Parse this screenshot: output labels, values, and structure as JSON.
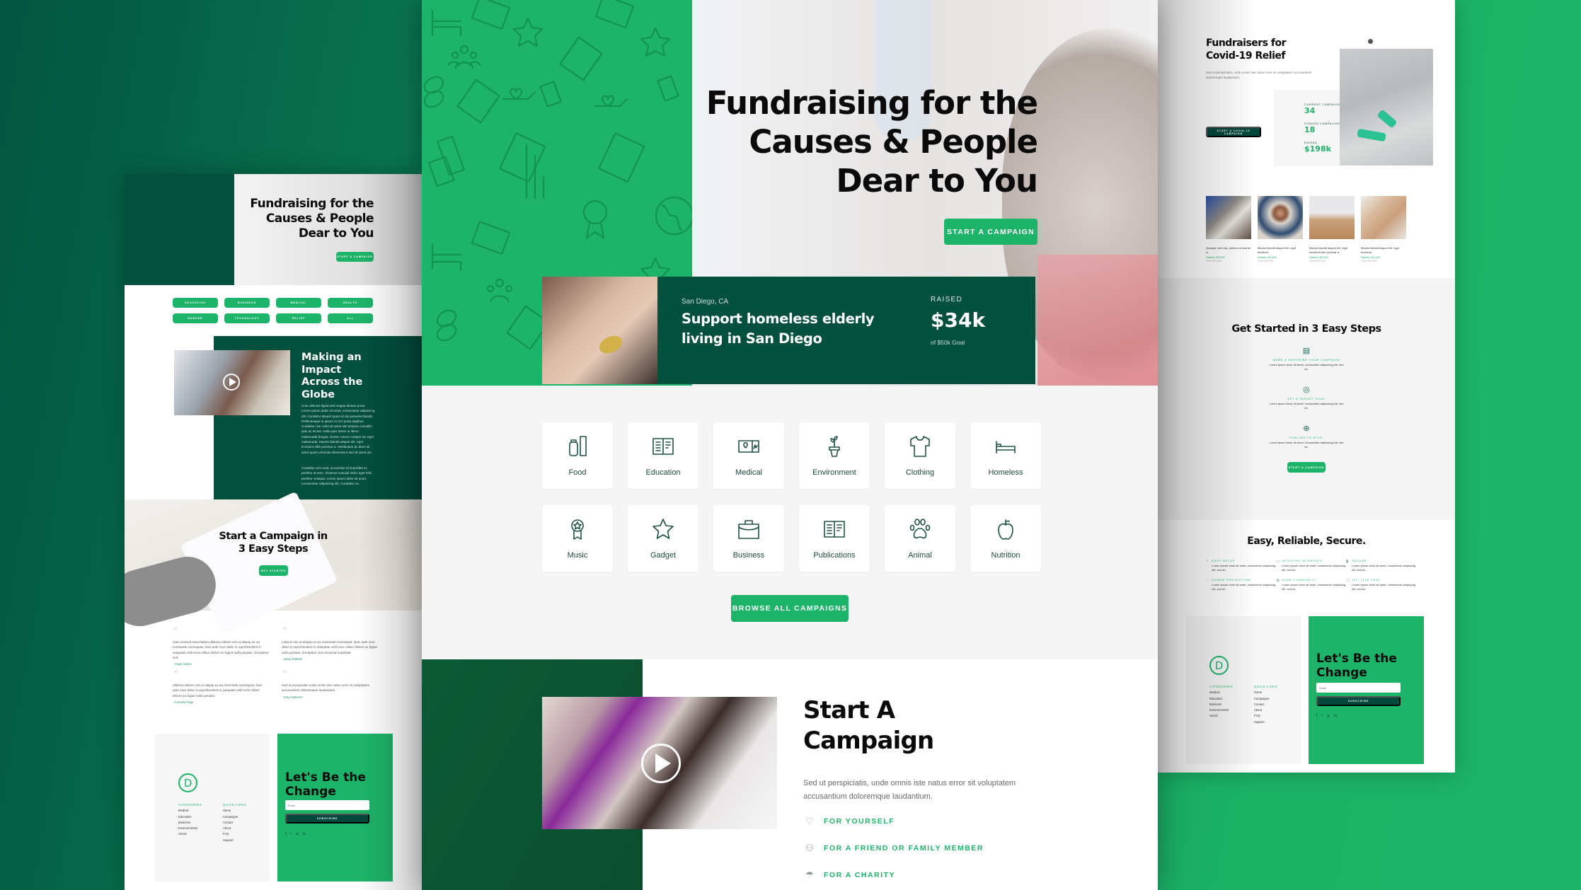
{
  "colors": {
    "accent": "#1db469",
    "dark_green": "#03503f",
    "text_dark": "#0a0a0a"
  },
  "left_page": {
    "hero": {
      "title": "Fundraising for the Causes & People Dear to You",
      "button": "Start a Campaign"
    },
    "category_buttons": [
      "Education",
      "Business",
      "Medical",
      "Health",
      "Hunger",
      "Technology",
      "Relief",
      "All"
    ],
    "impact": {
      "title": "Making an Impact Across the Globe",
      "para1": "Cras ultricies ligula sed magna dictum porta. Lorem ipsum dolor sit amet, consectetur adipiscing elit. Curabitur aliquet quam id dui posuere blandit. Pellentesque in ipsum id orci porta dapibus. Curabitur non nulla sit amet nisl tempus convallis quis ac lectus. Nulla quis lorem ut libero malesuada feugiat. Donec rutrum congue leo eget malesuada. Mauris blandit aliquet elit, eget tincidunt nibh pulvinar a. Vestibulum ac diam sit amet quam vehicula elementum sed sit amet dui.",
      "para2": "Curabitur arcu erat, accumsan id imperdiet et, porttitor at sem. Vivamus suscipit tortor eget felis porttitor volutpat. Lorem ipsum dolor sit amet, consectetur adipiscing elit. Curabitur no.",
      "play_icon": "play-icon"
    },
    "steps": {
      "title": "Start a Campaign in 3 Easy Steps",
      "button": "Get Started"
    },
    "testimonials": [
      {
        "quote": "Quis nostrud exercitation ullamco laboris nisi ut aliquip ex ea commodo consequat. Duis aute irure dolor in reprehenderit in voluptate velit esse cillum dolore eu fugiat nulla pariatur. Excepteur sint.",
        "author": "- Angie Garcia"
      },
      {
        "quote": "Laboris nisi ut aliquip ex ea commodo consequat. Duis aute irure dolor in reprehenderit in voluptate velit esse cillum dolore eu fugiat nulla pariatur. Excepteur sint occaecat cupidatat.",
        "author": "- Jesus Roberts"
      },
      {
        "quote": "ullamco laboris nisi ut aliquip ex ea commodo consequat. Duis aute irure dolor in reprehenderit in voluptate velit esse cillum dolore eu fugiat nulla pariatur.",
        "author": "- Cornelia Page"
      },
      {
        "quote": "Sed ut perspiciatis unde omnis iste natus error sit voluptatem accusantium doloremque laudantium.",
        "author": "- Tony Gutierrez"
      }
    ],
    "footer": {
      "logo": "D",
      "categories_heading": "Categories",
      "categories": [
        "Medical",
        "Education",
        "Business",
        "Environmental",
        "Social"
      ],
      "links_heading": "Quick Links",
      "links": [
        "Home",
        "Campaigns",
        "Contact",
        "About",
        "FAQ",
        "Support"
      ],
      "cta_title": "Let's Be the Change",
      "email_placeholder": "Email",
      "subscribe": "Subscribe",
      "social": [
        "f",
        "t",
        "◎",
        "in"
      ]
    }
  },
  "center_page": {
    "hero": {
      "title_lines": [
        "Fundraising for the",
        "Causes & People",
        "Dear to You"
      ],
      "button": "Start a Campaign"
    },
    "featured": {
      "location": "San Diego, CA",
      "title_lines": [
        "Support homeless elderly",
        "living in San Diego"
      ],
      "raised_label": "Raised",
      "raised_value": "$34k",
      "goal": "of $50k Goal"
    },
    "categories": [
      {
        "label": "Food",
        "icon": "food-icon"
      },
      {
        "label": "Education",
        "icon": "education-icon"
      },
      {
        "label": "Medical",
        "icon": "medical-icon"
      },
      {
        "label": "Environment",
        "icon": "environment-icon"
      },
      {
        "label": "Clothing",
        "icon": "clothing-icon"
      },
      {
        "label": "Homeless",
        "icon": "homeless-icon"
      },
      {
        "label": "Music",
        "icon": "music-icon"
      },
      {
        "label": "Gadget",
        "icon": "gadget-icon"
      },
      {
        "label": "Business",
        "icon": "business-icon"
      },
      {
        "label": "Publications",
        "icon": "publications-icon"
      },
      {
        "label": "Animal",
        "icon": "animal-icon"
      },
      {
        "label": "Nutrition",
        "icon": "nutrition-icon"
      }
    ],
    "browse_button": "Browse All Campaigns",
    "start": {
      "title_lines": [
        "Start A",
        "Campaign"
      ],
      "description": "Sed ut perspiciatis, unde omnis iste natus error sit voluptatem accusantium doloremque laudantium.",
      "options": [
        {
          "label": "For Yourself",
          "icon": "heart-icon",
          "glyph": "♡"
        },
        {
          "label": "For a Friend or Family Member",
          "icon": "people-icon",
          "glyph": "⚇"
        },
        {
          "label": "For a Charity",
          "icon": "charity-hand-icon",
          "glyph": "☂"
        }
      ]
    }
  },
  "right_page": {
    "covid": {
      "title_lines": [
        "Fundraisers for",
        "Covid-19 Relief"
      ],
      "description": "Sed ut perspiciatis, unde omnis iste natus error sit voluptatem accusantium doloremque laudantium.",
      "button": "Start a Covid-19 Campaign",
      "stats": [
        {
          "label": "Current Campaigns",
          "value": "34"
        },
        {
          "label": "Funded Campaigns",
          "value": "18"
        },
        {
          "label": "Raised",
          "value": "$198k"
        }
      ]
    },
    "campaign_cards": [
      {
        "title": "Quisque velit nisi, pretium ut lacinia in.",
        "raised": "Raised: $3,500",
        "goal": "Goal: $10,000"
      },
      {
        "title": "Mauris blandit aliquet elit, eget tincidunt.",
        "raised": "Raised: $3,500",
        "goal": "Goal: $10,000"
      },
      {
        "title": "Mauris blandit aliquet elit, eget tincidunt nibh pulvinar a.",
        "raised": "Raised: $3,500",
        "goal": "Goal: $10,000"
      },
      {
        "title": "Mauris blandit aliquet elit, eget tincidunt.",
        "raised": "Raised: $3,500",
        "goal": "Goal: $10,000"
      }
    ],
    "steps": {
      "title": "Get Started in 3 Easy Steps",
      "items": [
        {
          "heading": "Name & Describe Your Campaign",
          "body": "Lorem ipsum dolor sit amet, consectetur adipiscing elit, sed do.",
          "icon": "document-icon",
          "glyph": "▤"
        },
        {
          "heading": "Set a Target Goal",
          "body": "Lorem ipsum dolor sit amet, consectetur adipiscing elit, sed do.",
          "icon": "target-icon",
          "glyph": "◎"
        },
        {
          "heading": "Publish to Rise!",
          "body": "Lorem ipsum dolor sit amet, consectetur adipiscing elit, sed do.",
          "icon": "globe-icon",
          "glyph": "⊕"
        }
      ],
      "button": "Start a Campaign"
    },
    "secure": {
      "title": "Easy, Reliable, Secure.",
      "features": [
        {
          "heading": "Easy Setup",
          "body": "Lorem ipsum dolor sit amet, consectetur adipiscing elit, sed do.",
          "icon": "lightbulb-icon",
          "glyph": "♀"
        },
        {
          "heading": "Intuitive Interface",
          "body": "Lorem ipsum dolor sit amet, consectetur adipiscing elit, sed do.",
          "icon": "monitor-icon",
          "glyph": "▭"
        },
        {
          "heading": "Secure",
          "body": "Lorem ipsum dolor sit amet, consectetur adipiscing elit, sed do.",
          "icon": "lock-icon",
          "glyph": "▮"
        },
        {
          "heading": "Donor Protection",
          "body": "Lorem ipsum dolor sit amet, consectetur adipiscing elit, sed do.",
          "icon": "shield-icon",
          "glyph": "◌"
        },
        {
          "heading": "Huge Community",
          "body": "Lorem ipsum dolor sit amet, consectetur adipiscing elit, sed do.",
          "icon": "community-icon",
          "glyph": "◍"
        },
        {
          "heading": "24/7 Live Chat",
          "body": "Lorem ipsum dolor sit amet, consectetur adipiscing elit, sed do.",
          "icon": "chat-icon",
          "glyph": "◻"
        }
      ]
    },
    "footer": {
      "logo": "D",
      "categories_heading": "Categories",
      "categories": [
        "Medical",
        "Education",
        "Business",
        "Environmental",
        "Social"
      ],
      "links_heading": "Quick Links",
      "links": [
        "Home",
        "Campaigns",
        "Contact",
        "About",
        "FAQ",
        "Support"
      ],
      "cta_title": "Let's Be the Change",
      "email_placeholder": "Email",
      "subscribe": "Subscribe",
      "social": [
        "f",
        "t",
        "◎",
        "in"
      ]
    }
  }
}
